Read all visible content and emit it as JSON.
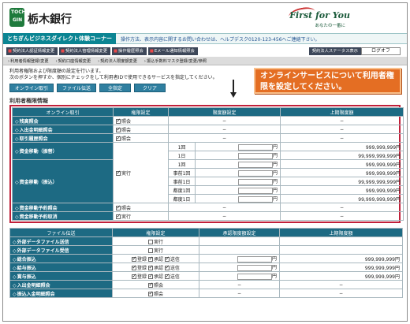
{
  "header": {
    "logo_top": "TOCHI",
    "logo_bottom": "GIN",
    "bank_name": "栃木銀行",
    "slogan": "First for You",
    "slogan_sub": "あなたの一番に"
  },
  "titlebar": {
    "service_name": "とちぎんビジネスダイレクト体験コーナー",
    "helpdesk": "操作方法、表示内容に関するお問い合わせは、ヘルプデスク0120-123-456へご連絡下さい。"
  },
  "nav_main": [
    "契約法人認証情報変更",
    "契約法人管理情報変更",
    "操作履歴照会",
    "Eメール通知情報照会"
  ],
  "nav_status": "契約法人ステータス表示",
  "logout_label": "ログオフ",
  "nav_sub": [
    "利用者情報登録/変更",
    "契約口座情報変更",
    "契約法人限度額変更",
    "振込手数料マスタ登録/変更/参照"
  ],
  "content": {
    "desc_line1": "利用者権限および限度額の設定を行います。",
    "desc_line2": "次のボタンを押すか、個別にチェックをして利用者IDで使用できるサービスを指定してください。",
    "buttons": [
      "オンライン取引",
      "ファイル伝送",
      "全指定",
      "クリア"
    ],
    "callout": "オンラインサービスについて利用者権限を設定してください。",
    "section_title": "利用者権限情報"
  },
  "online_table": {
    "headers": [
      "オンライン取引",
      "権限設定",
      "限度額設定",
      "上期限度額"
    ],
    "rows": [
      {
        "name": "残高照会",
        "perm": "照会",
        "limit": "−",
        "max": "−"
      },
      {
        "name": "入出金明細照会",
        "perm": "照会",
        "limit": "−",
        "max": "−"
      },
      {
        "name": "取引履歴照会",
        "perm": "照会",
        "limit": "−",
        "max": "−"
      },
      {
        "name": "資金移動（振替）",
        "perm": "実行",
        "sub": [
          {
            "label": "1回",
            "unit": "円",
            "max": "999,999,999円"
          },
          {
            "label": "1日",
            "unit": "円",
            "max": "99,999,999,999円"
          }
        ]
      },
      {
        "name": "資金移動（振込）",
        "sub": [
          {
            "label": "1回",
            "unit": "円",
            "max": "999,999,999円"
          },
          {
            "label": "事前1回",
            "unit": "円",
            "max": "999,999,999円"
          },
          {
            "label": "事前1日",
            "unit": "円",
            "max": "99,999,999,999円"
          },
          {
            "label": "都度1回",
            "unit": "円",
            "max": "999,999,999円"
          },
          {
            "label": "都度1日",
            "unit": "円",
            "max": "99,999,999,999円"
          }
        ]
      },
      {
        "name": "資金移動予約照会",
        "perm": "照会",
        "limit": "−",
        "max": "−"
      },
      {
        "name": "資金移動予約取消",
        "perm": "実行",
        "limit": "−",
        "max": "−"
      }
    ]
  },
  "file_table": {
    "headers": [
      "ファイル伝送",
      "権限設定",
      "承認限度額設定",
      "上期限度額"
    ],
    "rows": [
      {
        "name": "外部データファイル送信",
        "perms": [
          "実行"
        ],
        "limit": "",
        "max": ""
      },
      {
        "name": "外部データファイル受信",
        "perms": [
          "実行"
        ],
        "limit": "",
        "max": ""
      },
      {
        "name": "総合振込",
        "perms": [
          "登録",
          "承認",
          "送信"
        ],
        "limit": "円",
        "max": "999,999,999円"
      },
      {
        "name": "給与振込",
        "perms": [
          "登録",
          "承認",
          "送信"
        ],
        "limit": "円",
        "max": "999,999,999円"
      },
      {
        "name": "賞与振込",
        "perms": [
          "登録",
          "承認",
          "送信"
        ],
        "limit": "円",
        "max": "999,999,999円"
      },
      {
        "name": "入出金明細照会",
        "perms": [
          "照会"
        ],
        "limit": "−",
        "max": "−"
      },
      {
        "name": "振込入金明細照会",
        "perms": [
          "照会"
        ],
        "limit": "−",
        "max": "−"
      }
    ]
  },
  "colors": {
    "accent_teal": "#0b8593",
    "table_header": "#1d6a83",
    "callout_orange": "#e46e23",
    "highlight_red": "#c0203a",
    "brand_green": "#1e7a3c"
  }
}
